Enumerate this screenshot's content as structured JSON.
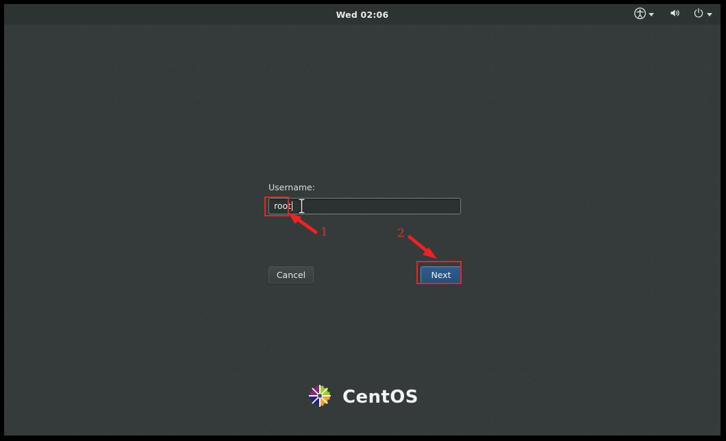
{
  "topbar": {
    "clock": "Wed 02:06",
    "tray": [
      {
        "name": "accessibility-icon",
        "icon": "universal-access",
        "has_caret": true
      },
      {
        "name": "volume-icon",
        "icon": "speaker-volume",
        "has_caret": false
      },
      {
        "name": "power-icon",
        "icon": "power",
        "has_caret": true
      }
    ]
  },
  "login": {
    "username_label": "Username:",
    "username_value": "root",
    "username_placeholder": "",
    "cancel_label": "Cancel",
    "next_label": "Next"
  },
  "branding": {
    "wordmark": "CentOS",
    "logo_colors": {
      "magenta": "#932279",
      "green": "#9ccd2a",
      "orange": "#efa724",
      "blue": "#262577"
    }
  },
  "annotations": {
    "accent_color": "#ee2222",
    "items": [
      {
        "label": "1",
        "target": "username-entry"
      },
      {
        "label": "2",
        "target": "next-button"
      }
    ]
  },
  "theme": {
    "background": "#353b3b",
    "entry_background": "#2c3131",
    "next_button_background": "#2e5c8c",
    "cancel_button_background": "#3e4444",
    "text_color": "#e3e6e6"
  }
}
